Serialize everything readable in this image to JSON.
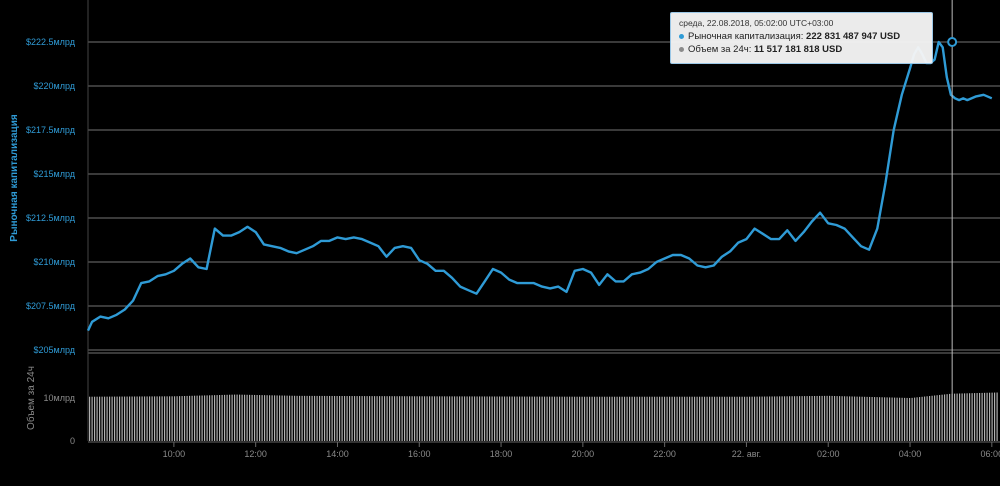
{
  "chart_data": {
    "type": "line",
    "title": "",
    "ylabel": "Рыночная капитализация",
    "ylabel_volume": "Объем за 24ч",
    "yticks": [
      "$205млрд",
      "$207.5млрд",
      "$210млрд",
      "$212.5млрд",
      "$215млрд",
      "$217.5млрд",
      "$220млрд",
      "$222.5млрд"
    ],
    "ytick_values": [
      205,
      207.5,
      210,
      212.5,
      215,
      217.5,
      220,
      222.5
    ],
    "ylim": [
      205,
      222.5
    ],
    "volume_ticks": [
      "0",
      "10млрд"
    ],
    "volume_tick_values": [
      0,
      10
    ],
    "xticks": [
      "10:00",
      "12:00",
      "14:00",
      "16:00",
      "18:00",
      "20:00",
      "22:00",
      "22. авг.",
      "02:00",
      "04:00",
      "06:00"
    ],
    "xtick_hours": [
      10,
      12,
      14,
      16,
      18,
      20,
      22,
      24,
      26,
      28,
      30
    ],
    "xlim_hours": [
      7.9,
      30.2
    ],
    "grid": true,
    "series": [
      {
        "name": "Рыночная капитализация",
        "unit": "млрд USD",
        "color": "#2f9bd6",
        "x_hours": [
          7.9,
          8.0,
          8.2,
          8.4,
          8.6,
          8.8,
          9.0,
          9.2,
          9.4,
          9.6,
          9.8,
          10.0,
          10.2,
          10.4,
          10.6,
          10.8,
          11.0,
          11.2,
          11.4,
          11.6,
          11.8,
          12.0,
          12.2,
          12.4,
          12.6,
          12.8,
          13.0,
          13.2,
          13.4,
          13.6,
          13.8,
          14.0,
          14.2,
          14.4,
          14.6,
          14.8,
          15.0,
          15.2,
          15.4,
          15.6,
          15.8,
          16.0,
          16.2,
          16.4,
          16.6,
          16.8,
          17.0,
          17.2,
          17.4,
          17.6,
          17.8,
          18.0,
          18.2,
          18.4,
          18.6,
          18.8,
          19.0,
          19.2,
          19.4,
          19.6,
          19.8,
          20.0,
          20.2,
          20.4,
          20.6,
          20.8,
          21.0,
          21.2,
          21.4,
          21.6,
          21.8,
          22.0,
          22.2,
          22.4,
          22.6,
          22.8,
          23.0,
          23.2,
          23.4,
          23.6,
          23.8,
          24.0,
          24.2,
          24.4,
          24.6,
          24.8,
          25.0,
          25.2,
          25.4,
          25.6,
          25.8,
          26.0,
          26.2,
          26.4,
          26.6,
          26.8,
          27.0,
          27.2,
          27.4,
          27.6,
          27.8,
          28.0,
          28.1,
          28.2,
          28.3,
          28.4,
          28.5,
          28.6,
          28.7,
          28.8,
          28.9,
          29.0,
          29.1,
          29.2,
          29.3,
          29.4,
          29.6,
          29.8,
          30.0,
          30.2
        ],
        "values": [
          206.1,
          206.6,
          206.9,
          206.8,
          207.0,
          207.3,
          207.8,
          208.8,
          208.9,
          209.2,
          209.3,
          209.5,
          209.9,
          210.2,
          209.7,
          209.6,
          211.9,
          211.5,
          211.5,
          211.7,
          212.0,
          211.7,
          211.0,
          210.9,
          210.8,
          210.6,
          210.5,
          210.7,
          210.9,
          211.2,
          211.2,
          211.4,
          211.3,
          211.4,
          211.3,
          211.1,
          210.9,
          210.3,
          210.8,
          210.9,
          210.8,
          210.1,
          209.9,
          209.5,
          209.5,
          209.1,
          208.6,
          208.4,
          208.2,
          208.9,
          209.6,
          209.4,
          209.0,
          208.8,
          208.8,
          208.8,
          208.6,
          208.5,
          208.6,
          208.3,
          209.5,
          209.6,
          209.4,
          208.7,
          209.3,
          208.9,
          208.9,
          209.3,
          209.4,
          209.6,
          210.0,
          210.2,
          210.4,
          210.4,
          210.2,
          209.8,
          209.7,
          209.8,
          210.3,
          210.6,
          211.1,
          211.3,
          211.9,
          211.6,
          211.3,
          211.3,
          211.8,
          211.2,
          211.7,
          212.3,
          212.8,
          212.2,
          212.1,
          211.9,
          211.4,
          210.9,
          210.7,
          211.9,
          214.5,
          217.5,
          219.5,
          221.0,
          221.8,
          222.2,
          221.8,
          221.3,
          221.3,
          221.5,
          222.5,
          222.2,
          220.5,
          219.5,
          219.3,
          219.2,
          219.3,
          219.2,
          219.4,
          219.5,
          219.3
        ]
      },
      {
        "name": "Объем за 24ч",
        "unit": "млрд USD",
        "color": "#8a8a8a",
        "type": "bar",
        "x_range_hours": [
          7.9,
          30.2
        ],
        "values_by_hour": {
          "x_hours": [
            7.9,
            10.0,
            11.5,
            13.0,
            16.0,
            20.0,
            24.0,
            26.0,
            28.0,
            29.0,
            30.2
          ],
          "values": [
            10.3,
            10.4,
            10.8,
            10.5,
            10.4,
            10.3,
            10.3,
            10.5,
            10.0,
            11.0,
            11.3
          ]
        }
      }
    ]
  },
  "tooltip": {
    "date": "среда, 22.08.2018, 05:02:00 UTC+03:00",
    "cap_label": "Рыночная капитализация:",
    "cap_value": "222 831 487 947 USD",
    "vol_label": "Объем за 24ч:",
    "vol_value": "11 517 181 818 USD",
    "hover_hour": 29.03,
    "cap_dot_color": "#2f9bd6",
    "vol_dot_color": "#8a8a8a"
  },
  "colors": {
    "background": "#000000",
    "gridline": "#9a9a9a",
    "line": "#2f9bd6",
    "volume_bar": "#b0b0b0",
    "axis_text_cap": "#2f9bd6",
    "axis_text_volume": "#8a8a8a"
  }
}
